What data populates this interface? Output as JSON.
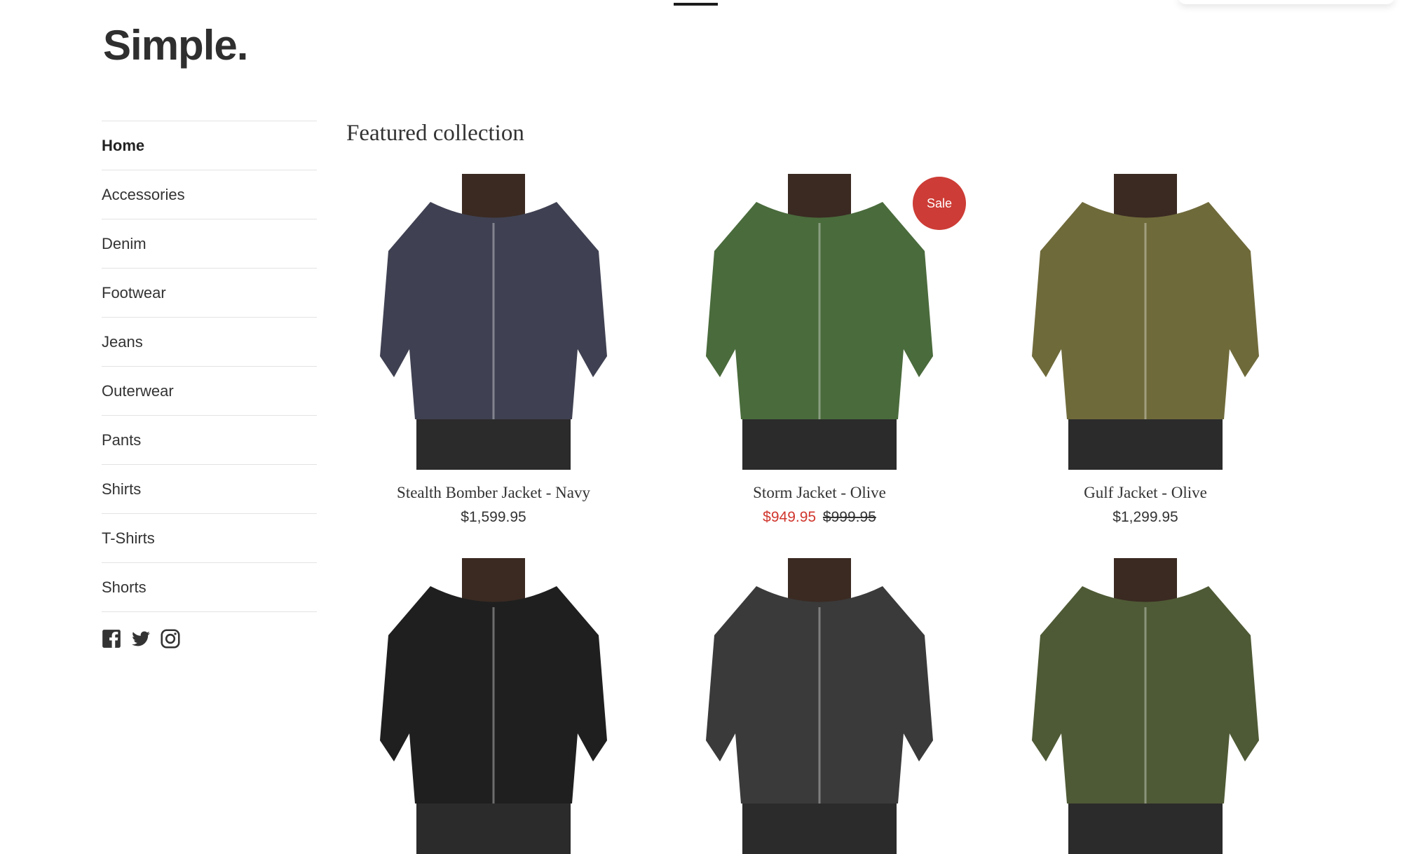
{
  "store": {
    "logo": "Simple."
  },
  "sidebar": {
    "items": [
      {
        "label": "Home",
        "active": true
      },
      {
        "label": "Accessories"
      },
      {
        "label": "Denim"
      },
      {
        "label": "Footwear"
      },
      {
        "label": "Jeans"
      },
      {
        "label": "Outerwear"
      },
      {
        "label": "Pants"
      },
      {
        "label": "Shirts"
      },
      {
        "label": "T-Shirts"
      },
      {
        "label": "Shorts"
      }
    ],
    "social": [
      "facebook-icon",
      "twitter-icon",
      "instagram-icon"
    ]
  },
  "main": {
    "section_title": "Featured collection",
    "products": [
      {
        "title": "Stealth Bomber Jacket - Navy",
        "price": "$1,599.95",
        "jacket_color": "#3f4152"
      },
      {
        "title": "Storm Jacket - Olive",
        "price": "$949.95",
        "compare_price": "$999.95",
        "badge": "Sale",
        "jacket_color": "#4a6b3c"
      },
      {
        "title": "Gulf Jacket - Olive",
        "price": "$1,299.95",
        "jacket_color": "#6f6a3a"
      },
      {
        "jacket_color": "#1f1f1f"
      },
      {
        "jacket_color": "#3a3a3a"
      },
      {
        "jacket_color": "#4e5a35"
      }
    ]
  },
  "colors": {
    "sale": "#d0362d",
    "badge": "#cd3c36",
    "text": "#333333",
    "divider": "#e3e3e3"
  }
}
